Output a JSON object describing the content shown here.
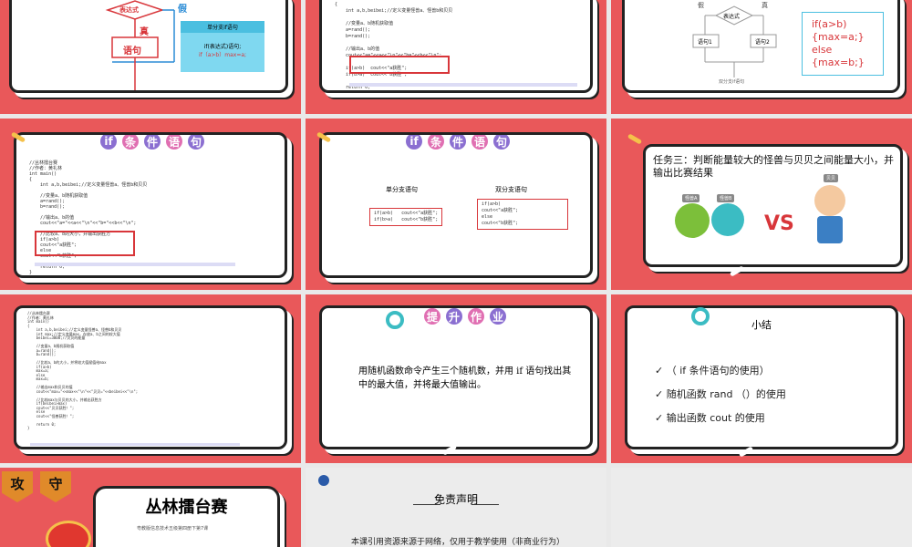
{
  "colors": {
    "slide_bg": "#e9585a",
    "accent_red": "#d8363a",
    "gray_bg": "#ececec"
  },
  "slide1": {
    "expr_label": "表达式",
    "false_label": "假",
    "true_label": "真",
    "stmt_label": "语句",
    "box_title": "单分支if语句",
    "box_line1": "if(表达式)语句;",
    "box_line2": "if（a>b）max=a;"
  },
  "slide2": {
    "code": "int main()\n{\n    int a,b,beibei;//定义变量怪兽a、怪兽b和贝贝\n\n    //变量a、b随机获取值\n    a=rand();\n    b=rand();\n\n    //输出a、b的值\n    cout<<\"a=\"<<a<<\"\\n\"<<\"b=\"<<b<<\"\\n\";\n\n    if(a>b)  cout<<\"a获胜\";\n    if(b>a)  cout<<\"b获胜\";\n\n    return 0;\n}"
  },
  "slide3": {
    "false_label": "假",
    "true_label": "真",
    "expr_label": "表达式",
    "stmt1": "语句1",
    "stmt2": "语句2",
    "footer": "双分支if语句",
    "code_lines": [
      "if(a>b)",
      "{max=a;}",
      "else",
      "{max=b;}"
    ]
  },
  "slide4": {
    "title_chars": [
      "if",
      "条",
      "件",
      "语",
      "句"
    ],
    "code": "//丛林擂台赛\n//作者：黄礼林\nint main()\n{\n    int a,b,beibei;//定义变量怪兽a、怪兽b和贝贝\n\n    //变量a、b随机获取值\n    a=rand();\n    b=rand();\n\n    //输出a、b的值\n    cout<<\"a=\"<<a<<\"\\n\"<<\"b=\"<<b<<\"\\n\";\n\n    //比较a、b的大小，并输出获胜方\n    if(a>b)\n    cout<<\"a获胜\";\n    else\n    cout<<\"b获胜\";\n\n    return 0;\n}"
  },
  "slide5": {
    "title_chars": [
      "if",
      "条",
      "件",
      "语",
      "句"
    ],
    "single_label": "单分支语句",
    "double_label": "双分支语句",
    "single_code": "if(a>b)   cout<<\"a获胜\";\nif(b>a)   cout<<\"b获胜\";",
    "double_code": "if(a>b)\ncout<<\"a获胜\";\nelse\ncout<<\"b获胜\";"
  },
  "slide6": {
    "task_text": "任务三：判断能量较大的怪兽与贝贝之间能量大小，并输出比赛结果",
    "monster_a": "怪兽A",
    "monster_b": "怪兽B",
    "beibei": "贝贝",
    "vs": "VS"
  },
  "slide7": {
    "code": "//丛林擂台赛\n//作者：黄礼林\nint main()\n{\n    int a,b,beibei;//定义变量怪兽a、怪兽b和贝贝\n    int max;//定义变量max，存放a、b之间的较大值\n    beibei=3000;//贝贝的能量\n\n    //变量a、b随机获取值\n    a=rand();\n    b=rand();\n\n    //比较a、b的大小，并将较大值赋值给max\n    if(a>b)\n    max=a;\n    else\n    max=b;\n\n    //输出max和贝贝的值\n    cout<<\"max=\"<<max<<\"\\n\"<<\"贝贝=\"<<beibei<<\"\\n\";\n\n    //比较max与贝贝的大小，并输出获胜方\n    if(beibei>max)\n    cout<<\"贝贝获胜！\";\n    else\n    cout<<\"怪兽获胜！\";\n\n    return 0;\n}"
  },
  "slide8": {
    "title_chars": [
      "提",
      "升",
      "作",
      "业"
    ],
    "body": "用随机函数命令产生三个随机数，并用 if 语句找出其中的最大值，并将最大值输出。"
  },
  "slide9": {
    "title": "小结",
    "items": [
      "（ if 条件语句的使用）",
      "随机函数  rand （）的使用",
      "输出函数 cout 的使用"
    ]
  },
  "slide10": {
    "badges": [
      "攻",
      "守"
    ],
    "title": "丛林擂台赛",
    "subtitle": "粤教版信息技术五级第四册下第7课"
  },
  "slide11": {
    "title": "免责声明",
    "body": "本课引用资源来源于网络，仅用于教学使用（非商业行为）"
  }
}
